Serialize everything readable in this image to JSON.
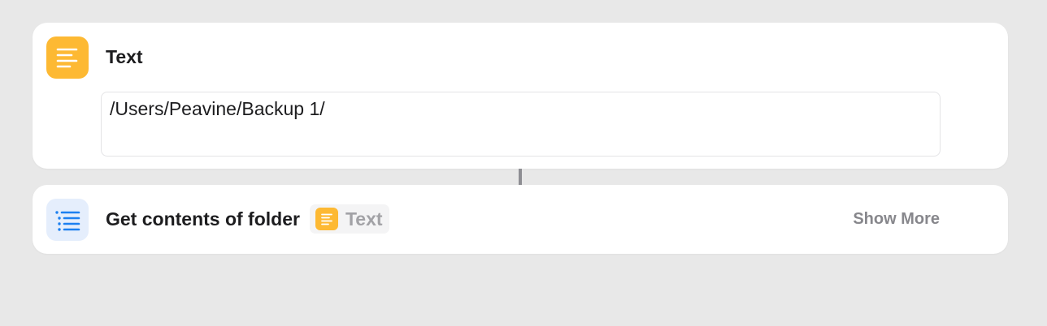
{
  "colors": {
    "background": "#e8e8e8",
    "card": "#ffffff",
    "text_icon": "#fdb933",
    "list_icon_bg": "#e5eefc",
    "list_icon_fg": "#1d80f0",
    "token_bg": "#f4f4f5",
    "token_label": "#a2a2a6",
    "show_more": "#87878c",
    "connector": "#8e8e93"
  },
  "text_action": {
    "icon": "text-lines-icon",
    "title": "Text",
    "value": "/Users/Peavine/Backup 1/"
  },
  "folder_action": {
    "icon": "list-icon",
    "title": "Get contents of folder",
    "token": {
      "icon": "text-lines-icon",
      "label": "Text"
    },
    "show_more": "Show More"
  }
}
